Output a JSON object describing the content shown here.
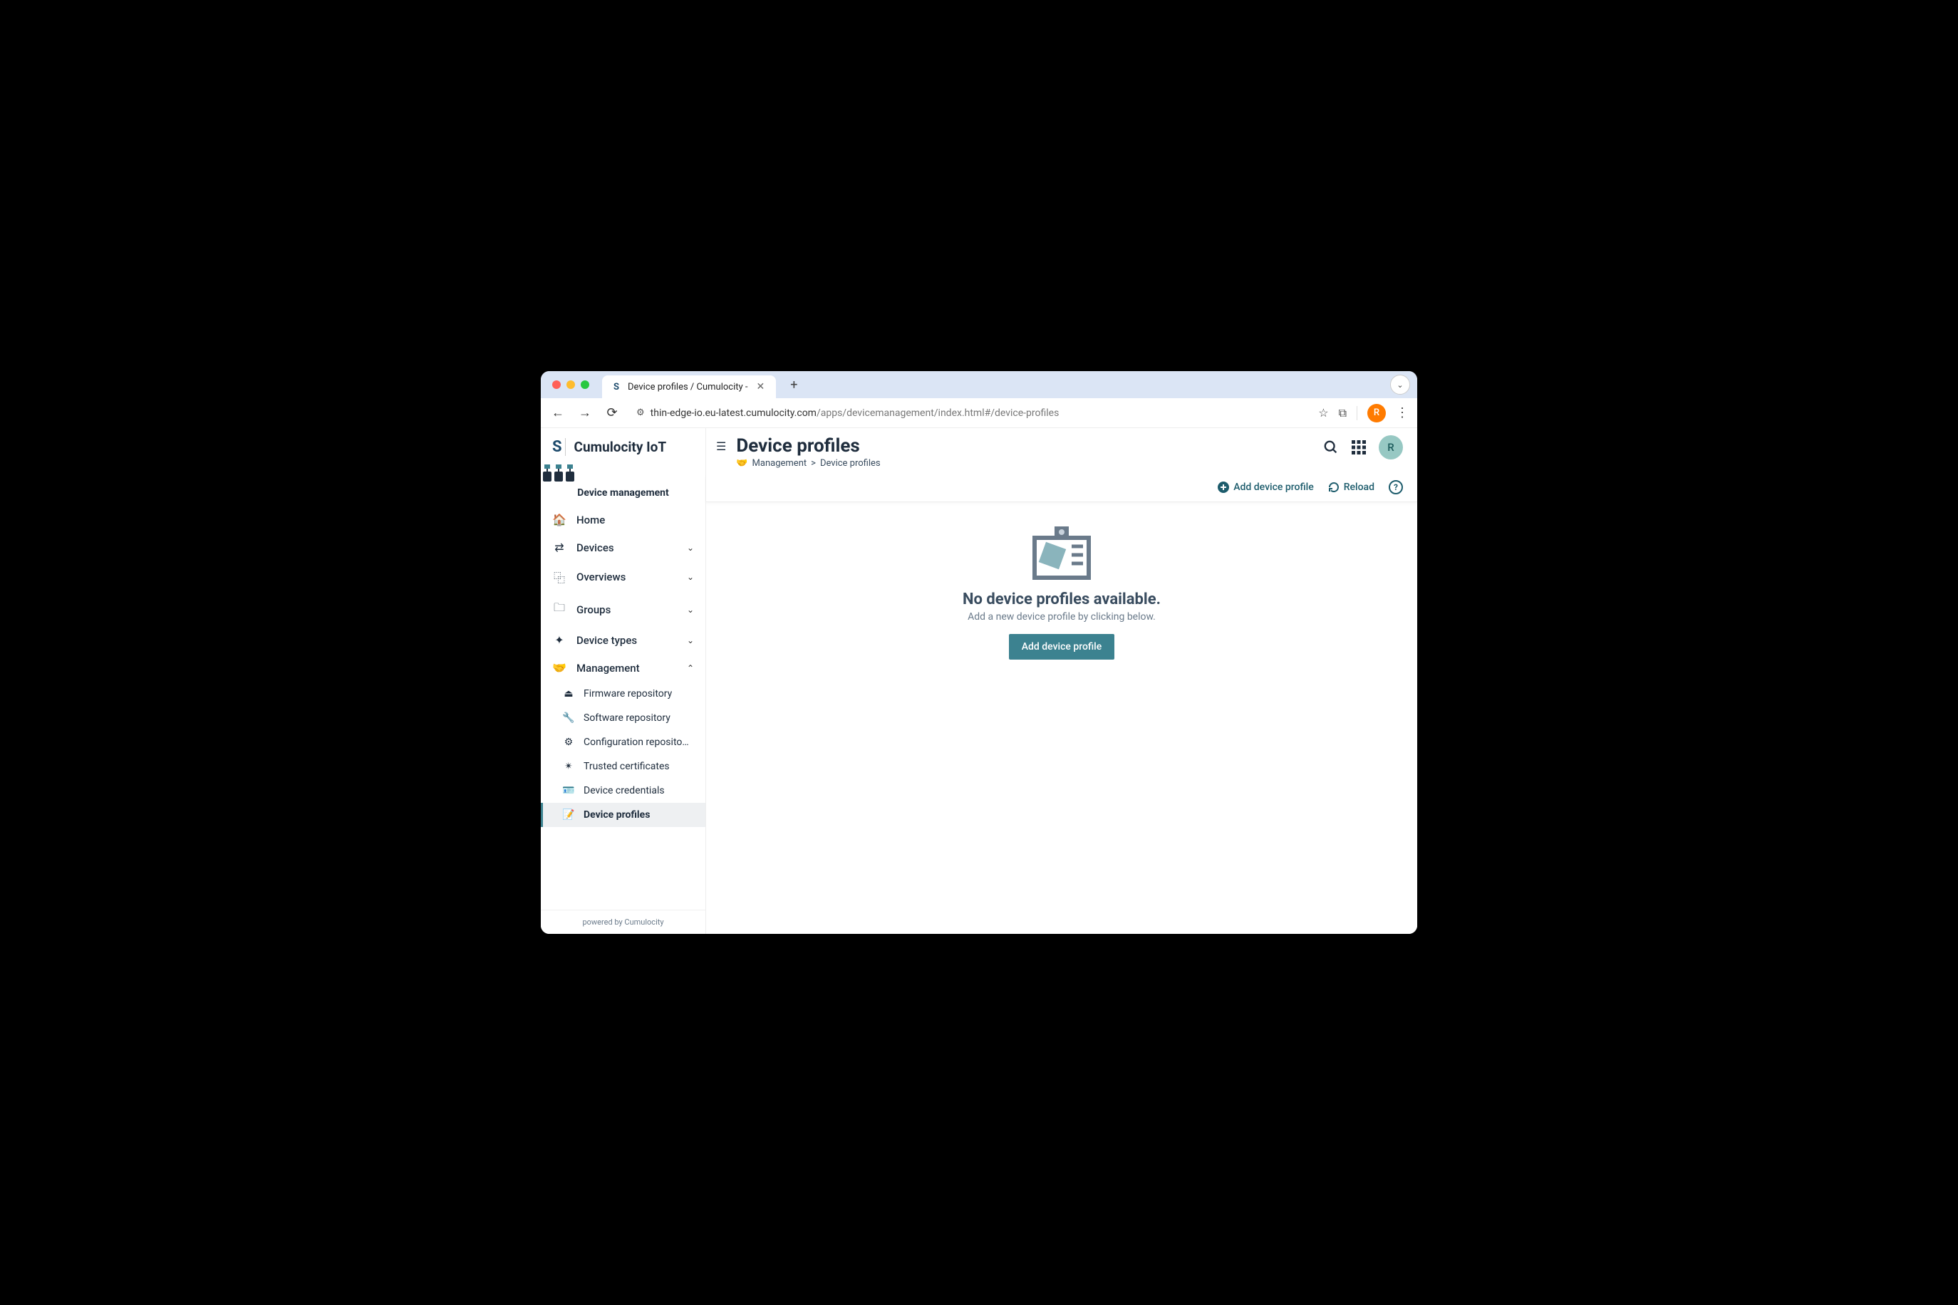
{
  "browser": {
    "tab": {
      "title": "Device profiles / Cumulocity -"
    },
    "url_host": "thin-edge-io.eu-latest.cumulocity.com",
    "url_path": "/apps/devicemanagement/index.html#/device-profiles",
    "avatar_letter": "R"
  },
  "sidebar": {
    "brand_name": "Cumulocity IoT",
    "app_name": "Device management",
    "items": [
      {
        "label": "Home",
        "icon": "🏠",
        "expand": false
      },
      {
        "label": "Devices",
        "icon": "⇄",
        "expand": true
      },
      {
        "label": "Overviews",
        "icon": "⿻",
        "expand": true
      },
      {
        "label": "Groups",
        "icon": "🗀",
        "expand": true
      },
      {
        "label": "Device types",
        "icon": "✦",
        "expand": true
      },
      {
        "label": "Management",
        "icon": "🤝",
        "expand": true,
        "open": true
      }
    ],
    "management_sub": [
      {
        "label": "Firmware repository",
        "icon": "⏏"
      },
      {
        "label": "Software repository",
        "icon": "🔧"
      },
      {
        "label": "Configuration reposito…",
        "icon": "⚙"
      },
      {
        "label": "Trusted certificates",
        "icon": "✴"
      },
      {
        "label": "Device credentials",
        "icon": "🪪"
      },
      {
        "label": "Device profiles",
        "icon": "📝",
        "active": true
      }
    ],
    "footer": "powered by Cumulocity"
  },
  "header": {
    "title": "Device profiles",
    "breadcrumb_parent": "Management",
    "breadcrumb_current": "Device profiles",
    "avatar_letter": "R"
  },
  "toolbar": {
    "add_label": "Add device profile",
    "reload_label": "Reload"
  },
  "empty": {
    "title": "No device profiles available.",
    "subtitle": "Add a new device profile by clicking below.",
    "button": "Add device profile"
  }
}
